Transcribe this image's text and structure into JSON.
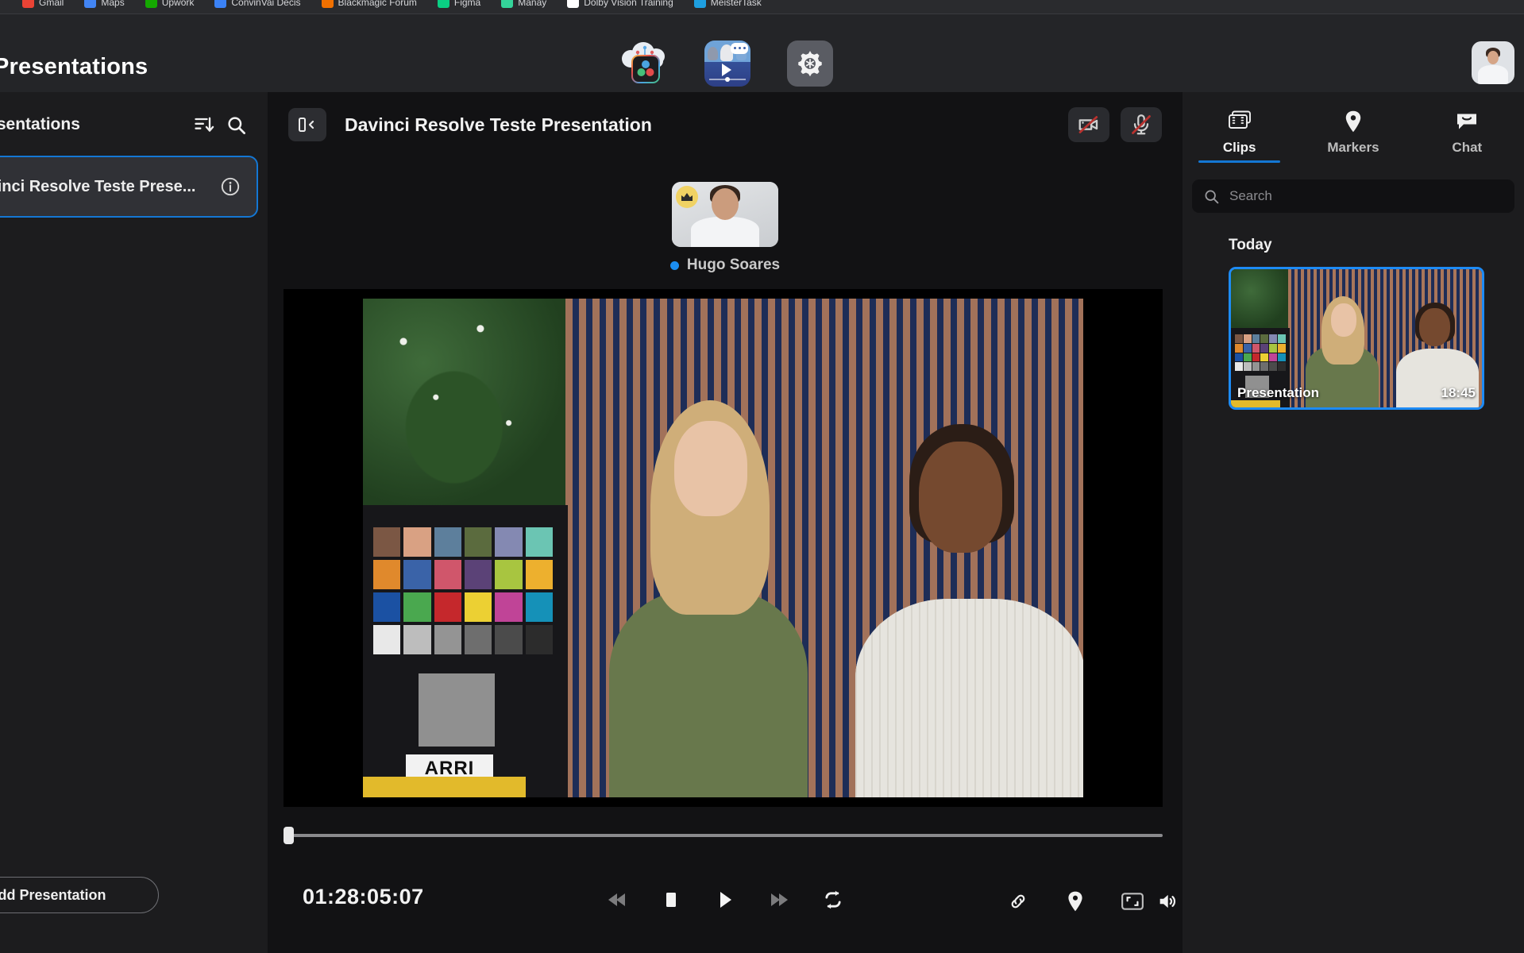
{
  "browser": {
    "bookmarks": [
      {
        "label": "Gmail",
        "color": "#ea4335"
      },
      {
        "label": "Maps",
        "color": "#4285f4"
      },
      {
        "label": "Upwork",
        "color": "#14a800"
      },
      {
        "label": "ConvinVai Decis",
        "color": "#3b82f6"
      },
      {
        "label": "Blackmagic Forum",
        "color": "#f07000"
      },
      {
        "label": "Figma",
        "color": "#0acf83"
      },
      {
        "label": "Manay",
        "color": "#34d399"
      },
      {
        "label": "Dolby Vision Training",
        "color": "#ffffff"
      },
      {
        "label": "MeisterTask",
        "color": "#1e9fe0"
      }
    ]
  },
  "topbar": {
    "app_title": "Presentations",
    "apps": [
      {
        "name": "blackmagic-cloud",
        "tooltip": "Blackmagic Cloud"
      },
      {
        "name": "presentations",
        "tooltip": "Presentations"
      },
      {
        "name": "settings",
        "tooltip": "Settings"
      }
    ],
    "avatar_alt": "Account"
  },
  "sidebar": {
    "title": "Presentations",
    "sort_icon": "sort-descending-icon",
    "search_icon": "search-icon",
    "items": [
      {
        "name": "Davinci Resolve Teste Prese...",
        "selected": true,
        "info_icon": "info-icon"
      }
    ],
    "add_button": "Add Presentation"
  },
  "main": {
    "collapse_icon": "panel-collapse-icon",
    "title": "Davinci Resolve Teste Presentation",
    "camera_toggle": {
      "name": "camera-off",
      "state": "off"
    },
    "mic_toggle": {
      "name": "microphone-off",
      "state": "off"
    },
    "participants": [
      {
        "name": "Hugo Soares",
        "host": true,
        "status": "online",
        "badge": "crown"
      }
    ],
    "player": {
      "timecode": "01:28:05:07",
      "progress_percent": 0,
      "controls": [
        {
          "name": "jump-to-start-button",
          "label": "Jump to start"
        },
        {
          "name": "stop-button",
          "label": "Stop"
        },
        {
          "name": "play-button",
          "label": "Play"
        },
        {
          "name": "jump-to-end-button",
          "label": "Jump to end"
        },
        {
          "name": "loop-button",
          "label": "Loop"
        }
      ],
      "volume_label": "Volume",
      "right_controls": [
        {
          "name": "link-button",
          "label": "Copy link"
        },
        {
          "name": "marker-button",
          "label": "Add marker"
        },
        {
          "name": "fullscreen-button",
          "label": "Fullscreen"
        }
      ]
    }
  },
  "right_panel": {
    "tabs": [
      {
        "label": "Clips",
        "icon": "clips-icon",
        "active": true
      },
      {
        "label": "Markers",
        "icon": "marker-icon",
        "active": false
      },
      {
        "label": "Chat",
        "icon": "chat-icon",
        "active": false
      }
    ],
    "search": {
      "placeholder": "Search",
      "value": "",
      "icon": "search-icon"
    },
    "groups": [
      {
        "title": "Today",
        "clips": [
          {
            "name": "Presentation",
            "duration": "18:45",
            "selected": true
          }
        ]
      }
    ]
  },
  "colors": {
    "accent": "#1477d4",
    "selection": "#1d8bf5",
    "app_bg": "#1c1c1e",
    "panel_bg": "#121214",
    "topbar_bg": "#242528",
    "status_online": "#1b8ef2"
  }
}
